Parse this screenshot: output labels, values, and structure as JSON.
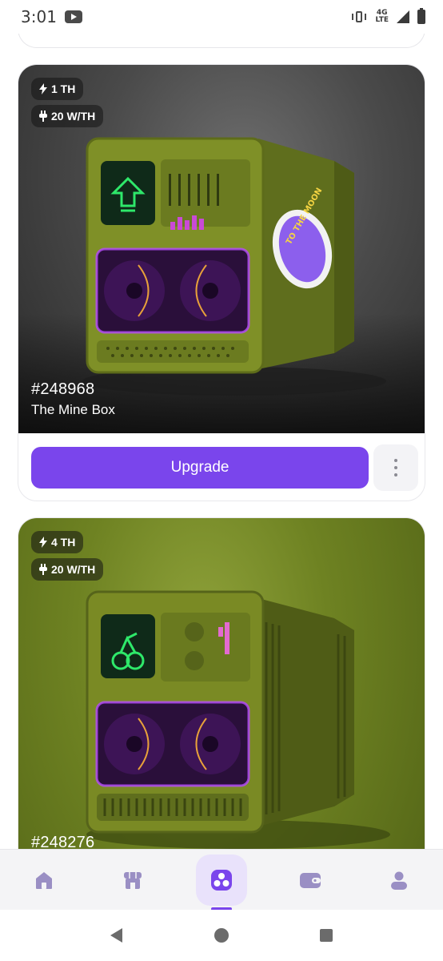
{
  "status_bar": {
    "time": "3:01",
    "network_top": "4G",
    "network_bottom": "LTE"
  },
  "cards": [
    {
      "hashrate": "1 TH",
      "efficiency": "20 W/TH",
      "id": "#248968",
      "name": "The Mine Box",
      "sticker_text": "TO THE MOON",
      "upgrade_label": "Upgrade",
      "background": "#3c3c3c"
    },
    {
      "hashrate": "4 TH",
      "efficiency": "20 W/TH",
      "id": "#248276",
      "name": "",
      "background": "#6e8222"
    }
  ],
  "bottom_nav": [
    {
      "icon": "home-icon",
      "active": false
    },
    {
      "icon": "marketplace-icon",
      "active": false
    },
    {
      "icon": "miners-icon",
      "active": true
    },
    {
      "icon": "wallet-icon",
      "active": false
    },
    {
      "icon": "profile-icon",
      "active": false
    }
  ],
  "colors": {
    "accent": "#7a45ec",
    "nav_icon": "#9a8fc4",
    "miner_body": "#8a9a2e",
    "screen_green": "#2ee86a",
    "glow_purple": "#b84cff"
  }
}
